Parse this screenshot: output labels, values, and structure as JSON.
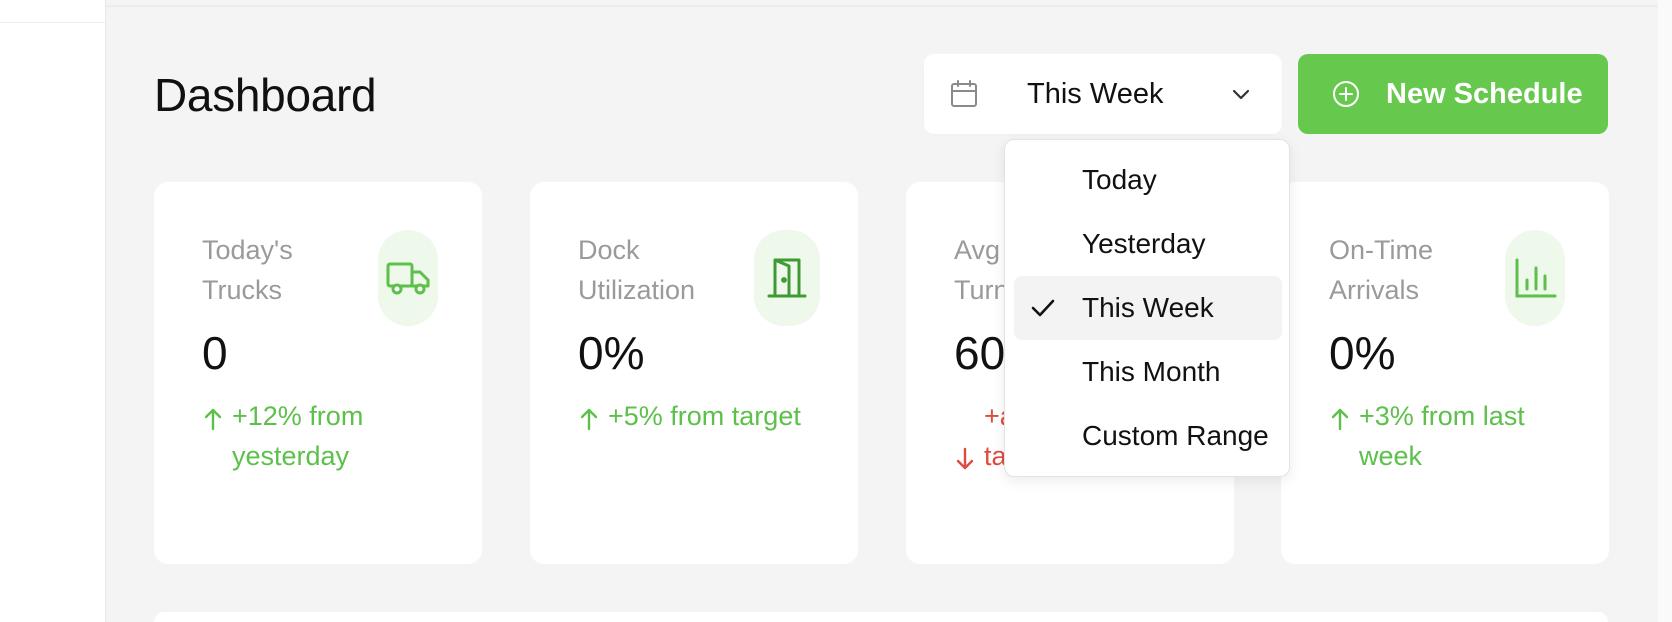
{
  "header": {
    "title": "Dashboard",
    "date_select": {
      "value": "This Week",
      "icon": "calendar-icon"
    },
    "new_button": {
      "label": "New Schedule",
      "icon": "plus-circle-icon"
    }
  },
  "dropdown": {
    "options": [
      "Today",
      "Yesterday",
      "This Week",
      "This Month",
      "Custom Range"
    ],
    "selected": "This Week"
  },
  "cards": [
    {
      "label": "Today's Trucks",
      "value": "0",
      "trend": "+12% from yesterday",
      "direction": "up",
      "icon": "truck-icon"
    },
    {
      "label": "Dock Utilization",
      "value": "0%",
      "trend": "+5% from target",
      "direction": "up",
      "icon": "door-icon"
    },
    {
      "label": "Avg Turn",
      "value": "60",
      "trend": "+a fr target",
      "direction": "down",
      "icon": ""
    },
    {
      "label": "On-Time Arrivals",
      "value": "0%",
      "trend": "+3% from last week",
      "direction": "up",
      "icon": "bar-chart-icon"
    }
  ],
  "colors": {
    "accent": "#66c94e",
    "positive": "#5cc04a",
    "negative": "#e04a3f",
    "icon_bg": "#eef8eb",
    "page_bg": "#f4f4f4"
  }
}
